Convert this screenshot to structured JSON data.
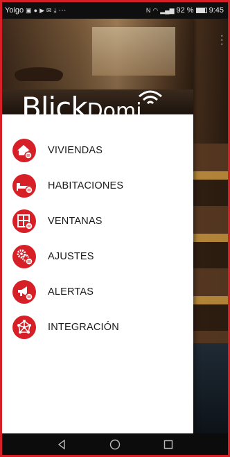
{
  "status_bar": {
    "carrier": "Yoigo",
    "left_icons": [
      "photo-icon",
      "chat-icon",
      "play-store-icon",
      "mail-icon",
      "download-icon"
    ],
    "more_indicator": "···",
    "nfc_label": "N",
    "signal": "92 %",
    "battery_level": 0.92,
    "time": "9:45"
  },
  "drawer": {
    "brand_primary": "Blick",
    "brand_secondary": "Domi",
    "items": [
      {
        "label": "VIVIENDAS",
        "icon": "house-icon"
      },
      {
        "label": "HABITACIONES",
        "icon": "bed-icon"
      },
      {
        "label": "VENTANAS",
        "icon": "window-icon"
      },
      {
        "label": "AJUSTES",
        "icon": "gear-icon"
      },
      {
        "label": "ALERTAS",
        "icon": "megaphone-icon"
      },
      {
        "label": "INTEGRACIÓN",
        "icon": "network-icon"
      }
    ]
  },
  "nav_bar": {
    "buttons": [
      "back-icon",
      "home-icon",
      "recents-icon"
    ]
  },
  "colors": {
    "accent": "#d61f26",
    "drawer_bg": "#ffffff",
    "status_bar_bg": "#0f0f0f"
  }
}
